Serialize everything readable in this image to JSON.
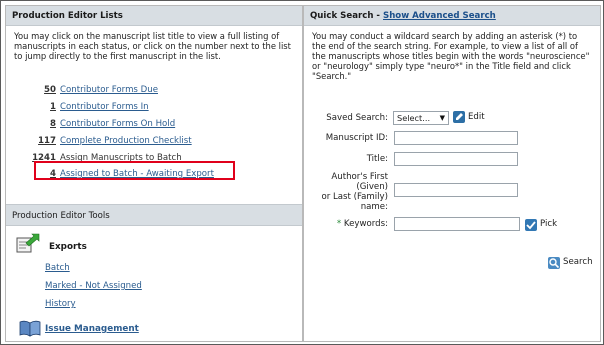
{
  "left_panel": {
    "title": "Production Editor Lists",
    "intro": "You may click on the manuscript list title to view a full listing of manuscripts in each status, or click on the number next to the list to jump directly to the first manuscript in the list.",
    "lists": [
      {
        "count": "50",
        "label": "Contributor Forms Due",
        "linked": true
      },
      {
        "count": "1",
        "label": "Contributor Forms In",
        "linked": true
      },
      {
        "count": "8",
        "label": "Contributor Forms On Hold",
        "linked": true
      },
      {
        "count": "117",
        "label": "Complete Production Checklist",
        "linked": true
      },
      {
        "count": "1241",
        "label": "Assign Manuscripts to Batch",
        "linked": false
      },
      {
        "count": "4",
        "label": "Assigned to Batch - Awaiting Export",
        "linked": true
      }
    ],
    "highlight_color": "#e0001b"
  },
  "tools": {
    "title": "Production Editor Tools",
    "exports_title": "Exports",
    "exports_icon": "export-arrow-icon",
    "exports_links": [
      "Batch",
      "Marked - Not Assigned",
      "History"
    ],
    "issue_title": "Issue Management",
    "issue_icon": "book-icon"
  },
  "right_panel": {
    "title": "Quick Search - ",
    "advanced_link": "Show Advanced Search",
    "intro": "You may conduct a wildcard search by adding an asterisk (*) to the end of the search string. For example, to view a list of all of the manuscripts whose titles begin with the words \"neuroscience\" or \"neurology\" simply type \"neuro*\" in the Title field and click \"Search.\"",
    "saved_search_label": "Saved Search:",
    "saved_search_value": "Select...",
    "edit_label": "Edit",
    "manuscript_id_label": "Manuscript ID:",
    "title_label": "Title:",
    "author_label_1": "Author's First",
    "author_label_2": "(Given)",
    "author_label_3": "or Last (Family)",
    "author_label_4": "name:",
    "keywords_required": "*",
    "keywords_label": " Keywords:",
    "pick_label": "Pick",
    "search_label": "Search",
    "manuscript_id_value": "",
    "title_value": "",
    "author_value": "",
    "keywords_value": ""
  }
}
